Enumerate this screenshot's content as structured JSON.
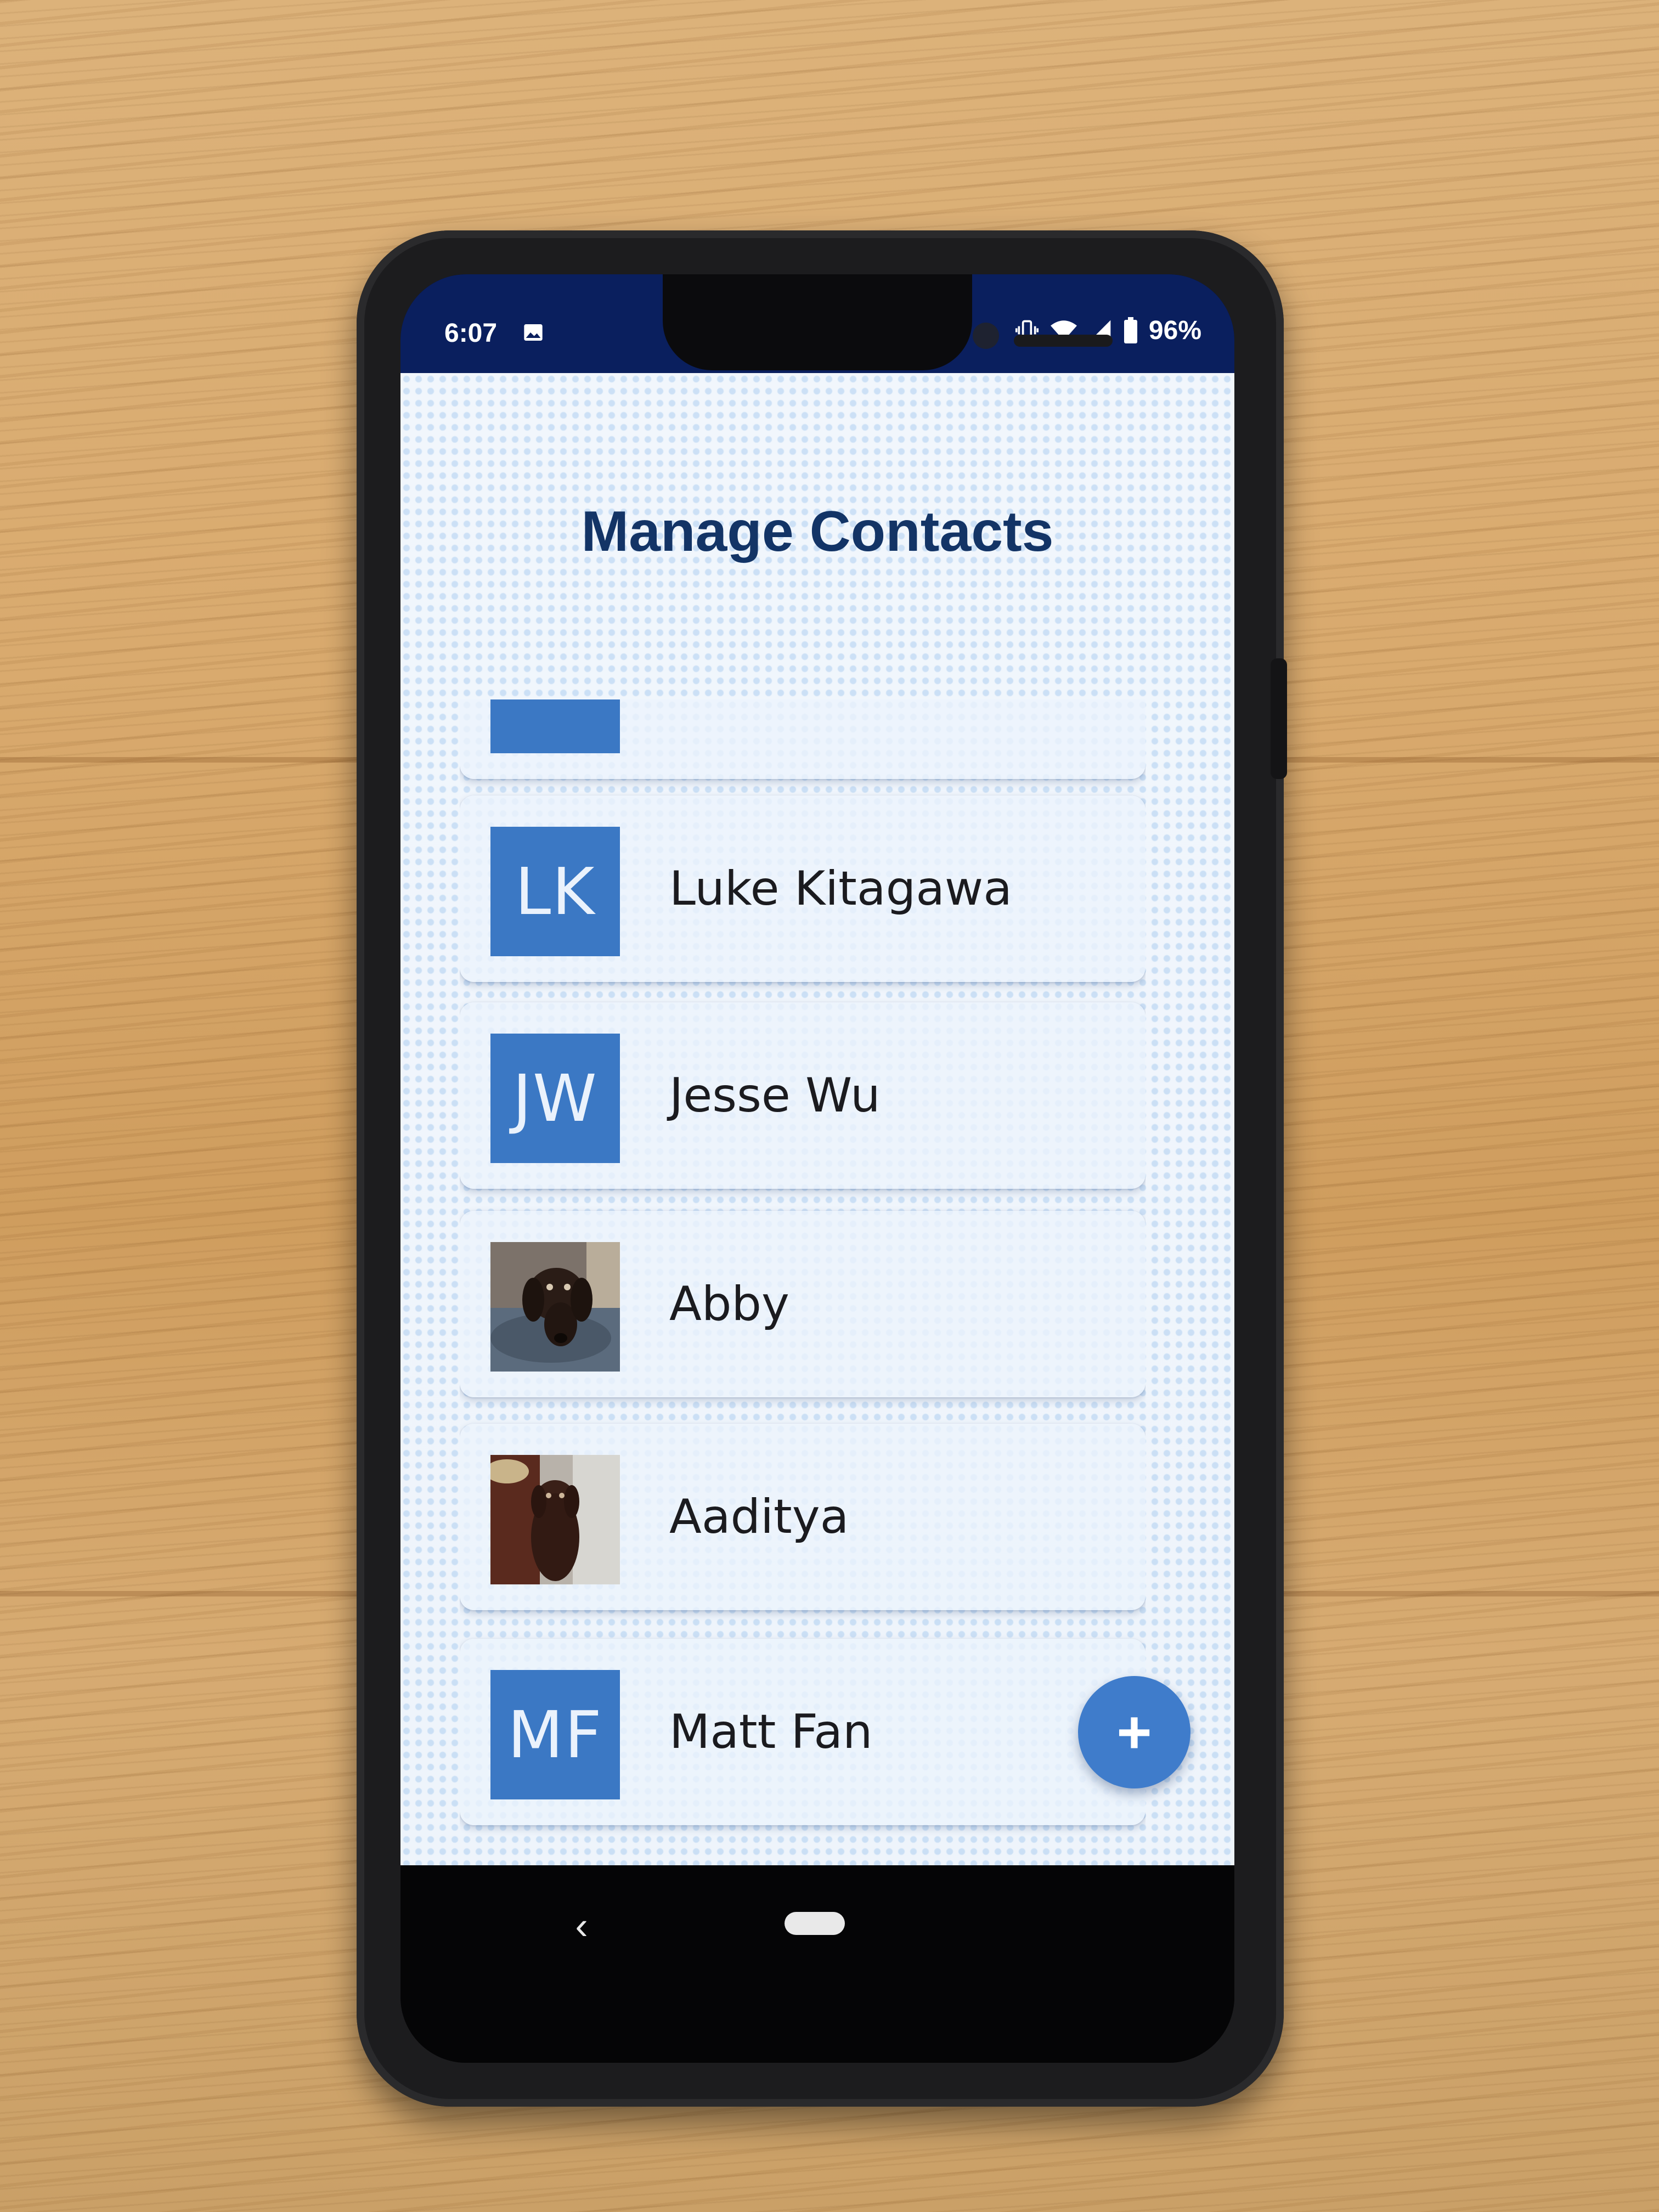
{
  "status_bar": {
    "time": "6:07",
    "battery": "96%",
    "icons": [
      "image-icon",
      "vibrate-icon",
      "wifi-icon",
      "signal-icon",
      "battery-icon"
    ]
  },
  "page": {
    "title": "Manage Contacts"
  },
  "contacts": [
    {
      "name": "",
      "initials": "",
      "avatar_type": "initials"
    },
    {
      "name": "Luke Kitagawa",
      "initials": "LK",
      "avatar_type": "initials"
    },
    {
      "name": "Jesse Wu",
      "initials": "JW",
      "avatar_type": "initials"
    },
    {
      "name": "Abby",
      "initials": "",
      "avatar_type": "photo",
      "photo_subject": "dog-photo"
    },
    {
      "name": "Aaditya",
      "initials": "",
      "avatar_type": "photo",
      "photo_subject": "dog-photo"
    },
    {
      "name": "Matt Fan",
      "initials": "MF",
      "avatar_type": "initials"
    }
  ],
  "fab": {
    "label": "+",
    "icon": "plus-icon"
  },
  "nav": {
    "back_glyph": "‹",
    "icons": [
      "back-icon",
      "home-pill-icon"
    ]
  },
  "colors": {
    "status_bar": "#0a1f5e",
    "title": "#133466",
    "avatar": "#3b78c4",
    "fab": "#3f7ccb"
  }
}
